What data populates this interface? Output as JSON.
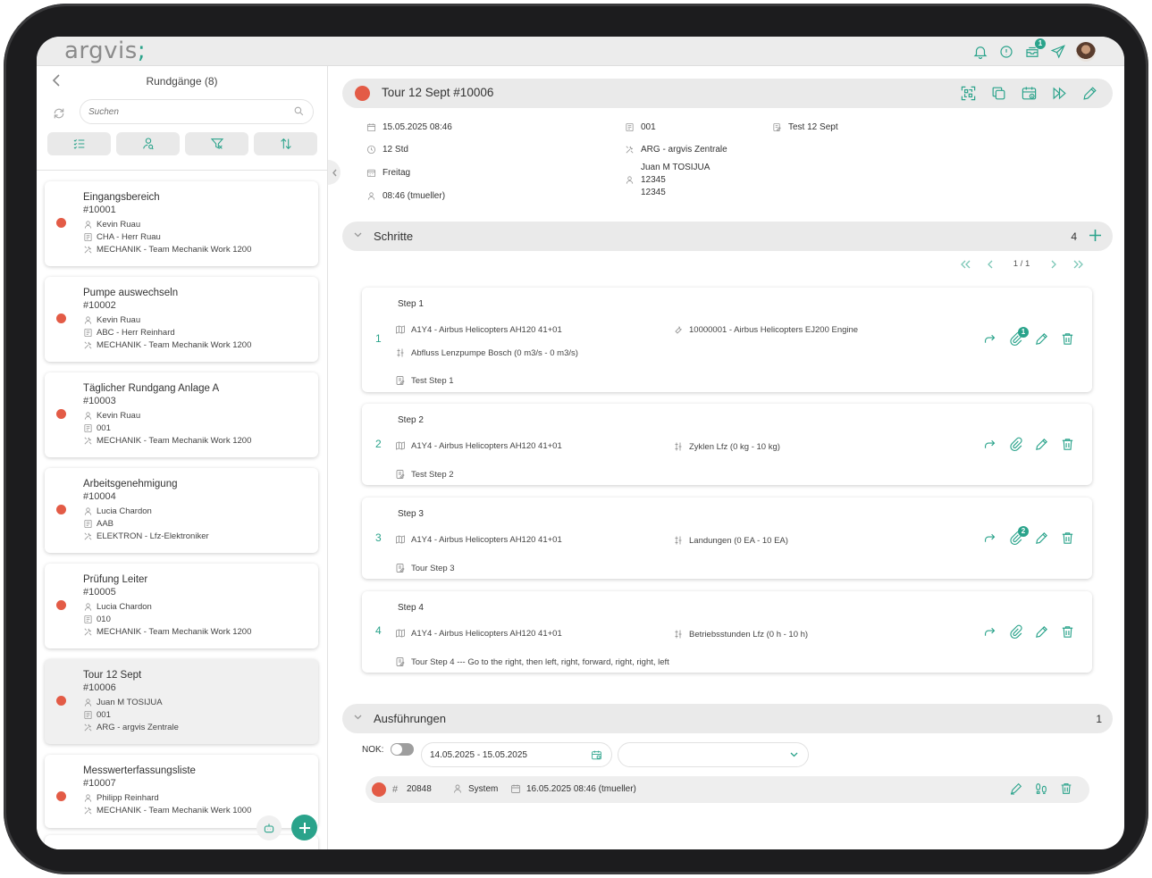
{
  "app": {
    "logo_part1": "argvis",
    "logo_part2": ";",
    "notification_badge": "1"
  },
  "colors": {
    "accent": "#2aa38b",
    "status_red": "#e35b46",
    "panel_grey": "#eaeaea"
  },
  "left": {
    "title": "Rundgänge (8)",
    "search_placeholder": "Suchen",
    "tools": [
      "list-check-icon",
      "user-search-icon",
      "filter-clear-icon",
      "sort-icon"
    ],
    "cards": [
      {
        "title": "Eingangsbereich",
        "number": "#10001",
        "person": "Kevin Ruau",
        "code": "CHA - Herr Ruau",
        "team": "MECHANIK - Team Mechanik Work 1200"
      },
      {
        "title": "Pumpe auswechseln",
        "number": "#10002",
        "person": "Kevin Ruau",
        "code": "ABC - Herr Reinhard",
        "team": "MECHANIK - Team Mechanik Work 1200"
      },
      {
        "title": "Täglicher Rundgang Anlage A",
        "number": "#10003",
        "person": "Kevin Ruau",
        "code": "001",
        "team": "MECHANIK - Team Mechanik Work 1200"
      },
      {
        "title": "Arbeitsgenehmigung",
        "number": "#10004",
        "person": "Lucia Chardon",
        "code": "AAB",
        "team": "ELEKTRON - Lfz-Elektroniker"
      },
      {
        "title": "Prüfung Leiter",
        "number": "#10005",
        "person": "Lucia Chardon",
        "code": "010",
        "team": "MECHANIK - Team Mechanik Work 1200"
      },
      {
        "title": "Tour 12 Sept",
        "number": "#10006",
        "person": "Juan M TOSIJUA",
        "code": "001",
        "team": "ARG - argvis Zentrale"
      },
      {
        "title": "Messwerterfassungsliste",
        "number": "#10007",
        "person": "Philipp Reinhard",
        "code": "",
        "team": "MECHANIK - Team Mechanik Werk 1000"
      }
    ]
  },
  "detail": {
    "title": "Tour 12 Sept #10006",
    "meta": {
      "date": "15.05.2025 08:46",
      "duration": "12 Std",
      "day": "Freitag",
      "time_user": "08:46 (tmueller)",
      "code": "001",
      "location": "ARG - argvis Zentrale",
      "person_name": "Juan M TOSIJUA",
      "person_id1": "12345",
      "person_id2": "12345",
      "note": "Test 12 Sept"
    },
    "steps_section": {
      "label": "Schritte",
      "count": "4"
    },
    "pager": {
      "label": "1 / 1"
    },
    "steps": [
      {
        "label": "Step 1",
        "num": "1",
        "object": "A1Y4 - Airbus Helicopters AH120 41+01",
        "component": "10000001 - Airbus Helicopters EJ200 Engine",
        "measure": "Abfluss Lenzpumpe Bosch (0 m3/s - 0 m3/s)",
        "note": "Test Step 1",
        "attachments": "1"
      },
      {
        "label": "Step 2",
        "num": "2",
        "object": "A1Y4 - Airbus Helicopters AH120 41+01",
        "measure": "Zyklen Lfz (0 kg - 10 kg)",
        "note": "Test Step 2",
        "attachments": ""
      },
      {
        "label": "Step 3",
        "num": "3",
        "object": "A1Y4 - Airbus Helicopters AH120 41+01",
        "measure": "Landungen (0 EA - 10 EA)",
        "note": "Tour Step 3",
        "attachments": "2"
      },
      {
        "label": "Step 4",
        "num": "4",
        "object": "A1Y4 - Airbus Helicopters AH120 41+01",
        "measure": "Betriebsstunden Lfz (0 h - 10 h)",
        "note": "Tour Step 4 --- Go to the right, then left, right, forward, right, right, left",
        "attachments": ""
      }
    ],
    "exec_section": {
      "label": "Ausführungen",
      "count": "1"
    },
    "filter": {
      "nok_label": "NOK:",
      "date_range": "14.05.2025 - 15.05.2025",
      "select_value": ""
    },
    "executions": [
      {
        "hash": "#",
        "id": "20848",
        "user": "System",
        "date": "16.05.2025 08:46 (tmueller)"
      }
    ]
  }
}
